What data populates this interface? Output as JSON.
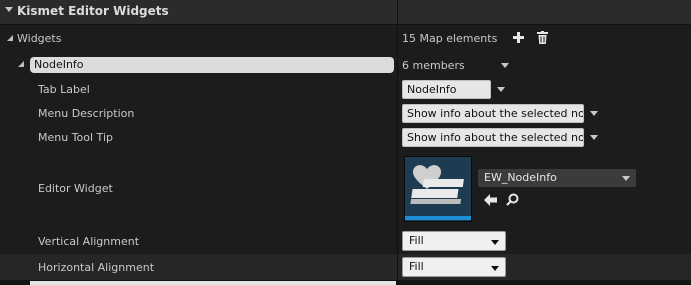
{
  "header": {
    "title": "Kismet Editor Widgets"
  },
  "widgets": {
    "label": "Widgets",
    "summary": "15 Map elements",
    "add_icon": "plus-icon",
    "delete_icon": "trash-icon"
  },
  "entry": {
    "key": "NodeInfo",
    "summary": "6 members"
  },
  "fields": {
    "tab_label": {
      "label": "Tab Label",
      "value": "NodeInfo"
    },
    "menu_description": {
      "label": "Menu Description",
      "value": "Show info about the selected node"
    },
    "menu_tooltip": {
      "label": "Menu Tool Tip",
      "value": "Show info about the selected node"
    },
    "editor_widget": {
      "label": "Editor Widget",
      "asset": "EW_NodeInfo",
      "use_icon": "arrow-left-icon",
      "browse_icon": "magnifier-icon"
    },
    "vertical_alignment": {
      "label": "Vertical Alignment",
      "value": "Fill"
    },
    "horizontal_alignment": {
      "label": "Horizontal Alignment",
      "value": "Fill"
    }
  },
  "colors": {
    "panel_bg": "#151515",
    "header_bg": "#2b2b2b",
    "row_light": "#262626",
    "row_dark": "#1c1c1c",
    "thumbnail_bg": "#1d3c52",
    "thumbnail_accent": "#1e8fd6"
  }
}
